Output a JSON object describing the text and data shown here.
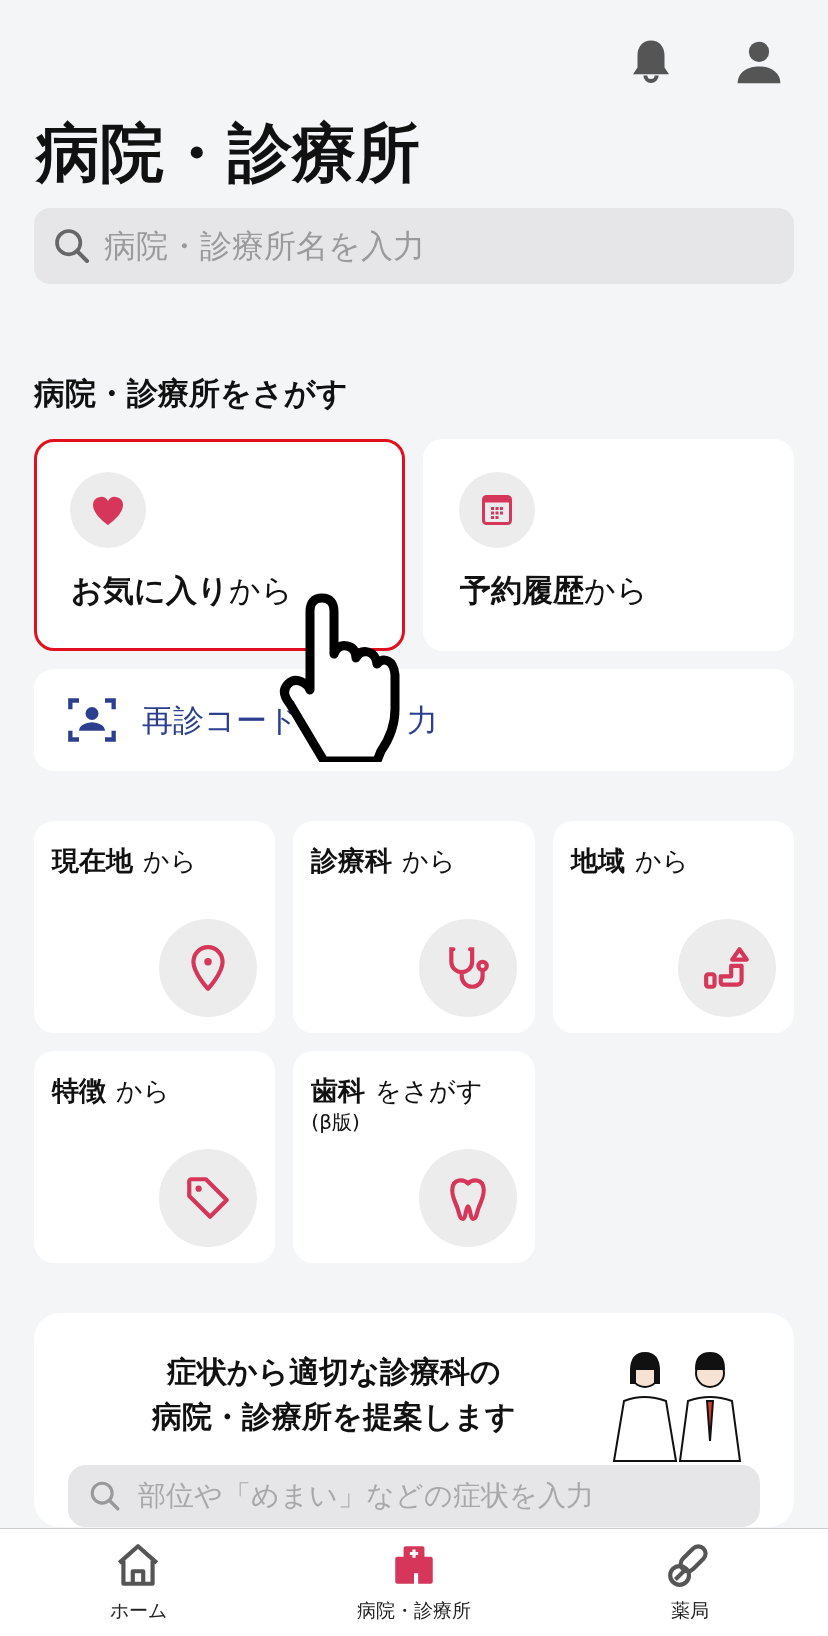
{
  "header": {
    "actions": [
      {
        "kind": "bell"
      },
      {
        "kind": "user"
      }
    ]
  },
  "title": "病院・診療所",
  "search": {
    "placeholder": "病院・診療所名を入力"
  },
  "section_heading": "病院・診療所をさがす",
  "quick_cards": [
    {
      "kind": "heart",
      "title": "お気に入り",
      "suffix": "から",
      "highlighted": true
    },
    {
      "kind": "calendar",
      "title": "予約履歴",
      "suffix": "から",
      "highlighted": false
    }
  ],
  "code_entry": {
    "text_visible_start": "再診コード",
    "text_visible_end": "力"
  },
  "search_cards": [
    {
      "kind": "pin",
      "title": "現在地",
      "suffix": "から"
    },
    {
      "kind": "stethoscope",
      "title": "診療科",
      "suffix": "から"
    },
    {
      "kind": "area",
      "title": "地域",
      "suffix": "から"
    },
    {
      "kind": "tag",
      "title": "特徴",
      "suffix": "から"
    },
    {
      "kind": "tooth",
      "title": "歯科",
      "suffix": "をさがす",
      "note": "(β版)"
    }
  ],
  "symptom_banner": {
    "lines": [
      "症状から適切な診療科の",
      "病院・診療所を提案します"
    ],
    "search": {
      "placeholder": "部位や「めまい」などの症状を入力"
    }
  },
  "bottom_nav": [
    {
      "kind": "home",
      "label": "ホーム",
      "selected": false
    },
    {
      "kind": "hospital",
      "label": "病院・診療所",
      "selected": true
    },
    {
      "kind": "pill",
      "label": "薬局",
      "selected": false
    }
  ]
}
